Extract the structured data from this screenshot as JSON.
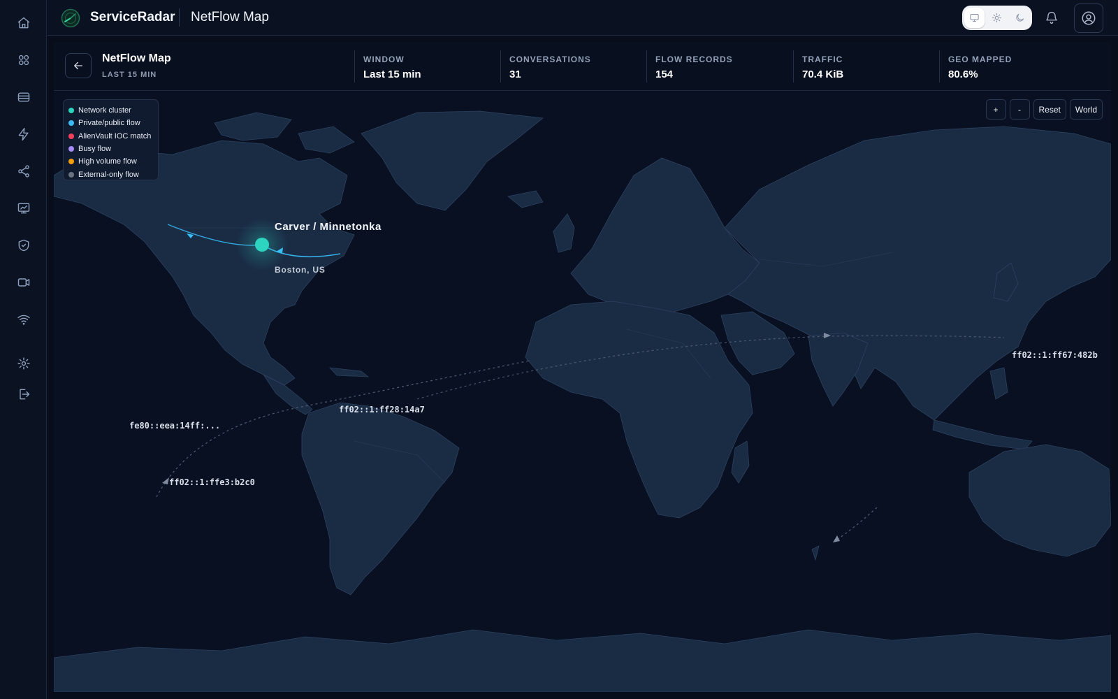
{
  "app": {
    "name": "ServiceRadar",
    "page_title": "NetFlow Map"
  },
  "sidebar": {
    "items": [
      {
        "name": "home-icon"
      },
      {
        "name": "dashboard-grid-icon"
      },
      {
        "name": "devices-icon"
      },
      {
        "name": "events-bolt-icon"
      },
      {
        "name": "network-share-icon"
      },
      {
        "name": "analytics-chart-icon"
      },
      {
        "name": "security-shield-icon"
      },
      {
        "name": "camera-video-icon"
      },
      {
        "name": "wifi-icon"
      },
      {
        "name": "settings-gear-icon"
      },
      {
        "name": "logout-icon"
      }
    ]
  },
  "topbar": {
    "theme_options": [
      "system",
      "light",
      "dark"
    ],
    "theme_selected": "system"
  },
  "header": {
    "title": "NetFlow Map",
    "subtitle": "LAST 15 MIN",
    "stats": [
      {
        "label": "WINDOW",
        "value": "Last 15 min"
      },
      {
        "label": "CONVERSATIONS",
        "value": "31"
      },
      {
        "label": "FLOW RECORDS",
        "value": "154"
      },
      {
        "label": "TRAFFIC",
        "value": "70.4 KiB"
      },
      {
        "label": "GEO MAPPED",
        "value": "80.6%"
      }
    ]
  },
  "legend": {
    "items": [
      {
        "label": "Network cluster",
        "color": "#2dd4bf"
      },
      {
        "label": "Private/public flow",
        "color": "#38bdf8"
      },
      {
        "label": "AlienVault IOC match",
        "color": "#f43f5e"
      },
      {
        "label": "Busy flow",
        "color": "#a78bfa"
      },
      {
        "label": "High volume flow",
        "color": "#f59e0b"
      },
      {
        "label": "External-only flow",
        "color": "#6b7280"
      }
    ]
  },
  "map_controls": {
    "zoom_in": "+",
    "zoom_out": "-",
    "reset": "Reset",
    "world": "World"
  },
  "map": {
    "cluster": {
      "title": "Carver / Minnetonka",
      "subtitle": "Boston, US",
      "color": "#2dd4bf"
    },
    "endpoint_labels": [
      "ff02::1:ff28:14a7",
      "fe80::eea:14ff:...",
      "ff02::1:ffe3:b2c0",
      "ff02::1:ff67:482b"
    ]
  }
}
